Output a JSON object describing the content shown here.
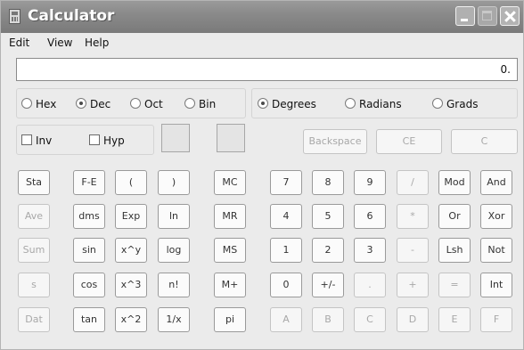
{
  "window": {
    "title": "Calculator"
  },
  "menu": [
    "Edit",
    "View",
    "Help"
  ],
  "display": {
    "value": "0."
  },
  "number_system": {
    "options": [
      "Hex",
      "Dec",
      "Oct",
      "Bin"
    ],
    "selected": "Dec"
  },
  "angle_unit": {
    "options": [
      "Degrees",
      "Radians",
      "Grads"
    ],
    "selected": "Degrees"
  },
  "modifiers": {
    "inv_label": "Inv",
    "hyp_label": "Hyp"
  },
  "edit_keys": {
    "backspace": "Backspace",
    "ce": "CE",
    "c": "C"
  },
  "stat_keys": [
    "Sta",
    "Ave",
    "Sum",
    "s",
    "Dat"
  ],
  "scientific_keys": {
    "col1": [
      "F-E",
      "dms",
      "sin",
      "cos",
      "tan"
    ],
    "col2": [
      "(",
      "Exp",
      "x^y",
      "x^3",
      "x^2"
    ],
    "col3": [
      ")",
      "ln",
      "log",
      "n!",
      "1/x"
    ]
  },
  "memory_keys": [
    "MC",
    "MR",
    "MS",
    "M+",
    "pi"
  ],
  "digit_rows": [
    [
      "7",
      "8",
      "9",
      "/",
      "Mod",
      "And"
    ],
    [
      "4",
      "5",
      "6",
      "*",
      "Or",
      "Xor"
    ],
    [
      "1",
      "2",
      "3",
      "-",
      "Lsh",
      "Not"
    ],
    [
      "0",
      "+/-",
      ".",
      "+",
      "=",
      "Int"
    ],
    [
      "A",
      "B",
      "C",
      "D",
      "E",
      "F"
    ]
  ]
}
